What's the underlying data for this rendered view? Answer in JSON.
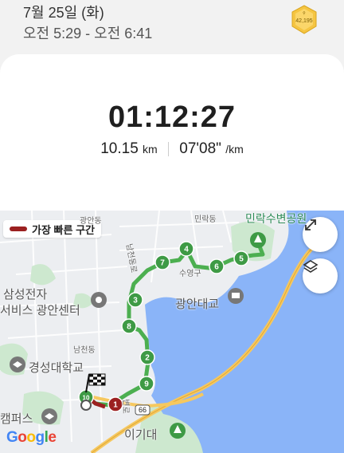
{
  "header": {
    "date": "7월 25일 (화)",
    "time_range": "오전 5:29 - 오전 6:41",
    "medal_text": "42,195"
  },
  "summary": {
    "duration": "01:12:27",
    "distance": "10.15",
    "distance_unit": "km",
    "pace": "07'08\"",
    "pace_unit": "/km"
  },
  "map": {
    "legend": "가장 빠른 구간",
    "road_number": "66",
    "watermark": "Google",
    "places": {
      "gwangan_dong": "광안동",
      "millak_dong": "민락동",
      "millak_park": "민락수변공원",
      "suyeong_gu": "수영구",
      "samsung_line1": "삼성전자",
      "samsung_line2": "서비스 광안센터",
      "gwangan_bridge": "광안대교",
      "namcheon_dong": "남천동",
      "kyungsung_univ": "경성대학교",
      "campus": "캠퍼스",
      "igidae": "이기대",
      "road_1": "남천동로",
      "road_2": "변로"
    },
    "km_markers": [
      "1",
      "2",
      "3",
      "4",
      "5",
      "6",
      "7",
      "8",
      "9",
      "10"
    ],
    "colors": {
      "route": "#4caf50",
      "marker": "#3e9a45",
      "fastest": "#9b2020",
      "sea": "#8ab4f8"
    }
  }
}
